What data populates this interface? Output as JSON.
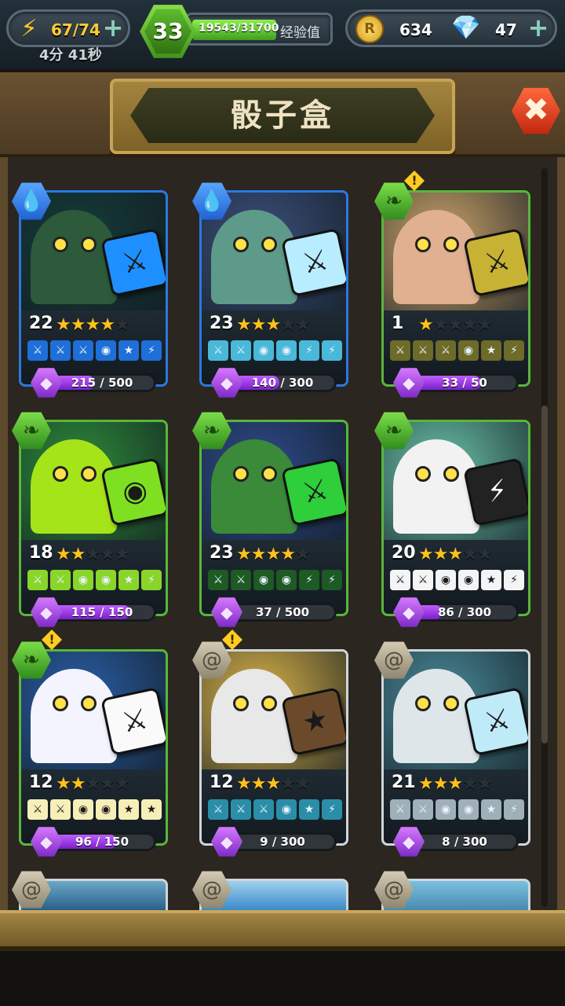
{
  "topbar": {
    "energy": "67/74",
    "energy_timer": "4分 41秒",
    "player_level": "33",
    "xp": "19543/31700",
    "xp_label": "经验值",
    "xp_fraction": 0.616,
    "coins": "634",
    "gems": "47"
  },
  "header": {
    "title": "骰子盒"
  },
  "cards": [
    {
      "level": "22",
      "stars": 4,
      "element": "water",
      "progress": "215 / 500",
      "fraction": 0.43,
      "alert": false,
      "art_bg": "#163b3a",
      "creature": "#2c5a3a",
      "die": "#1e8fff",
      "die_glyph": "⚔",
      "face_bg": "#1e6fd8",
      "faces": [
        "⚔",
        "⚔",
        "⚔",
        "◉",
        "★",
        "⚡"
      ]
    },
    {
      "level": "23",
      "stars": 3,
      "element": "water",
      "progress": "140 / 300",
      "fraction": 0.47,
      "alert": false,
      "art_bg": "#3b4f7a",
      "creature": "#5e9a8a",
      "die": "#b8ecff",
      "die_glyph": "⚔",
      "face_bg": "#4ab8d8",
      "faces": [
        "⚔",
        "⚔",
        "◉",
        "◉",
        "⚡",
        "⚡"
      ]
    },
    {
      "level": "1",
      "stars": 1,
      "element": "nature",
      "progress": "33 / 50",
      "fraction": 0.66,
      "alert": true,
      "art_bg": "#c9a26a",
      "creature": "#e0b090",
      "die": "#c7b233",
      "die_glyph": "⚔",
      "face_bg": "#6e6a28",
      "faces": [
        "⚔",
        "⚔",
        "⚔",
        "◉",
        "★",
        "⚡"
      ]
    },
    {
      "level": "18",
      "stars": 2,
      "element": "nature",
      "progress": "115 / 150",
      "fraction": 0.77,
      "alert": false,
      "art_bg": "#2e8c3a",
      "creature": "#a6e41a",
      "die": "#7ee020",
      "die_glyph": "◉",
      "face_bg": "#8ad52a",
      "faces": [
        "⚔",
        "⚔",
        "◉",
        "◉",
        "★",
        "⚡"
      ]
    },
    {
      "level": "23",
      "stars": 4,
      "element": "nature",
      "progress": "37 / 500",
      "fraction": 0.07,
      "alert": false,
      "art_bg": "#2e4a8a",
      "creature": "#3a8a3a",
      "die": "#2ecf3a",
      "die_glyph": "⚔",
      "face_bg": "#1d5a24",
      "faces": [
        "⚔",
        "⚔",
        "◉",
        "◉",
        "⚡",
        "⚡"
      ]
    },
    {
      "level": "20",
      "stars": 3,
      "element": "nature",
      "progress": "86 / 300",
      "fraction": 0.29,
      "alert": false,
      "art_bg": "#6ac1a8",
      "creature": "#f2f2f2",
      "die": "#222222",
      "die_glyph": "⚡",
      "face_bg": "#f4f4f4",
      "faces": [
        "⚔",
        "⚔",
        "◉",
        "◉",
        "★",
        "⚡"
      ]
    },
    {
      "level": "12",
      "stars": 2,
      "element": "nature",
      "progress": "96 / 150",
      "fraction": 0.64,
      "alert": true,
      "art_bg": "#2a5fa8",
      "creature": "#f4f4ff",
      "die": "#fafafa",
      "die_glyph": "⚔",
      "face_bg": "#f6efb8",
      "faces": [
        "⚔",
        "⚔",
        "◉",
        "◉",
        "★",
        "★"
      ]
    },
    {
      "level": "12",
      "stars": 3,
      "element": "neutral",
      "progress": "9 / 300",
      "fraction": 0.03,
      "alert": true,
      "art_bg": "#d9b34a",
      "creature": "#e8e8e8",
      "die": "#6a4a2a",
      "die_glyph": "★",
      "face_bg": "#2a8ea8",
      "faces": [
        "⚔",
        "⚔",
        "⚔",
        "◉",
        "★",
        "⚡"
      ]
    },
    {
      "level": "21",
      "stars": 3,
      "element": "neutral",
      "progress": "8 / 300",
      "fraction": 0.03,
      "alert": false,
      "art_bg": "#4a8a9a",
      "creature": "#dfe6ea",
      "die": "#bfeaf8",
      "die_glyph": "⚔",
      "face_bg": "#9fb0b8",
      "faces": [
        "⚔",
        "⚔",
        "◉",
        "◉",
        "★",
        "⚡"
      ]
    }
  ],
  "element_icons": {
    "water": "💧",
    "nature": "❧",
    "neutral": "@"
  },
  "gem_icon": "◆",
  "alert_icon": "!",
  "close_icon": "✖"
}
